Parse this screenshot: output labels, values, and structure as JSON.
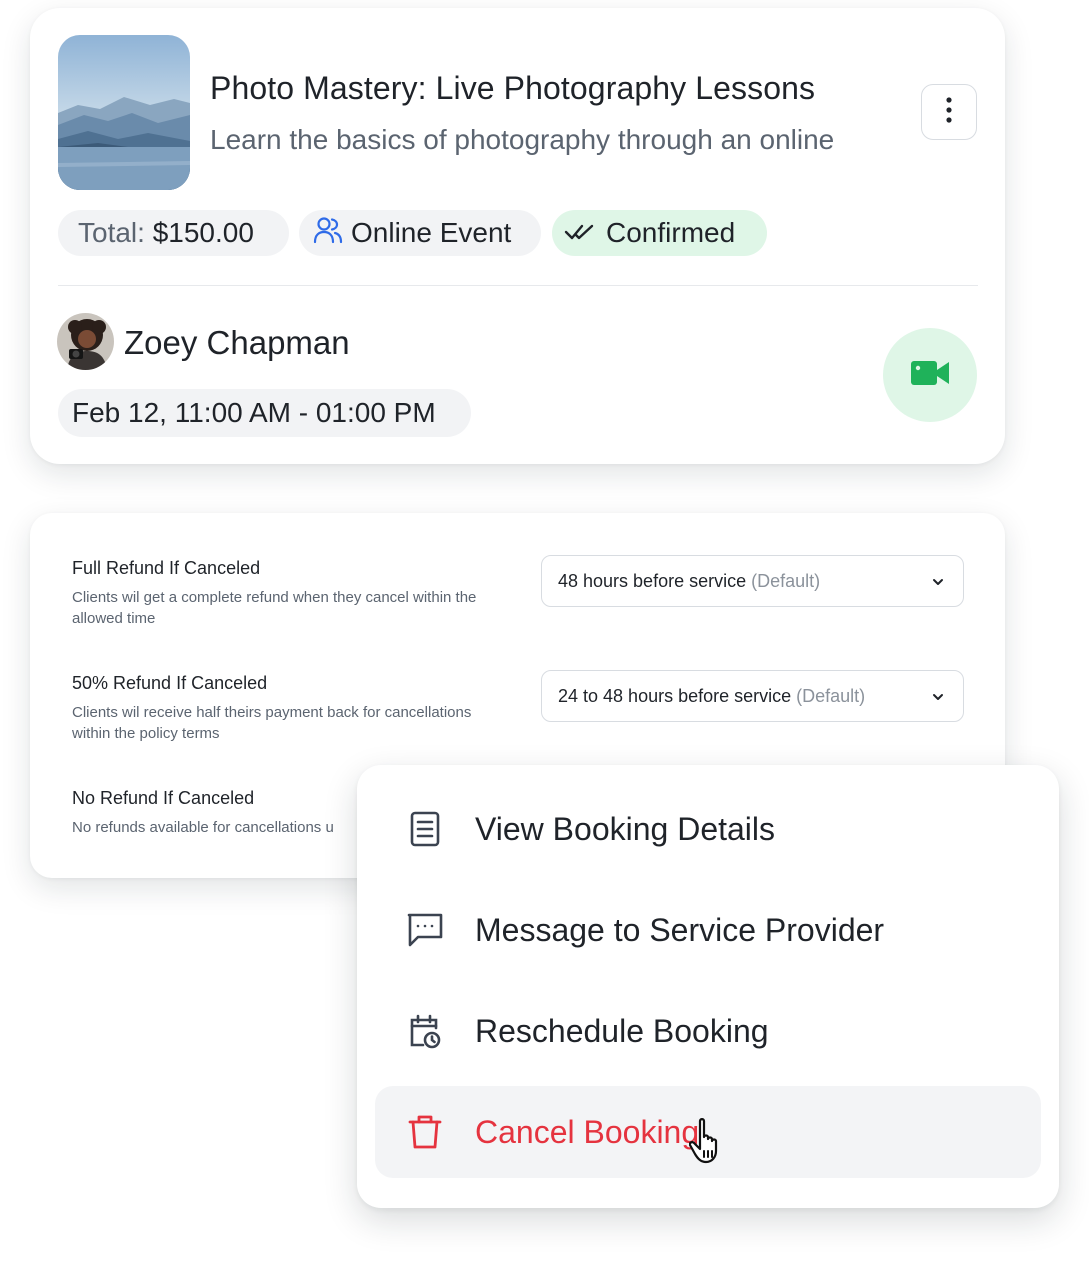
{
  "booking": {
    "title": "Photo Mastery: Live Photography Lessons",
    "subtitle": "Learn the basics of photography through an online",
    "total_label": "Total:",
    "total_value": "$150.00",
    "event_type": "Online Event",
    "status": "Confirmed",
    "host_name": "Zoey Chapman",
    "datetime": "Feb 12, 11:00 AM - 01:00 PM",
    "icons": {
      "more": "more-vertical-icon",
      "event_type": "users-icon",
      "status": "double-check-icon",
      "video": "video-camera-icon"
    },
    "colors": {
      "confirmed_bg": "#dff6e7",
      "accent_green": "#1fb25a",
      "accent_blue": "#2f6be8"
    }
  },
  "refund_policy": {
    "items": [
      {
        "title": "Full Refund If Canceled",
        "description": "Clients wil get a complete refund when they cancel within the allowed time",
        "select_value": "48 hours before service",
        "select_suffix": "(Default)"
      },
      {
        "title": "50% Refund If Canceled",
        "description": "Clients wil receive half theirs payment back for cancellations within the policy terms",
        "select_value": "24 to 48 hours before service",
        "select_suffix": "(Default)"
      },
      {
        "title": "No Refund If Canceled",
        "description": "No refunds available for cancellations u"
      }
    ]
  },
  "menu": {
    "items": [
      {
        "label": "View Booking Details",
        "icon": "document-icon"
      },
      {
        "label": "Message to Service Provider",
        "icon": "message-icon"
      },
      {
        "label": "Reschedule Booking",
        "icon": "calendar-clock-icon"
      },
      {
        "label": "Cancel Booking",
        "icon": "trash-icon",
        "color": "#e5333f"
      }
    ]
  }
}
